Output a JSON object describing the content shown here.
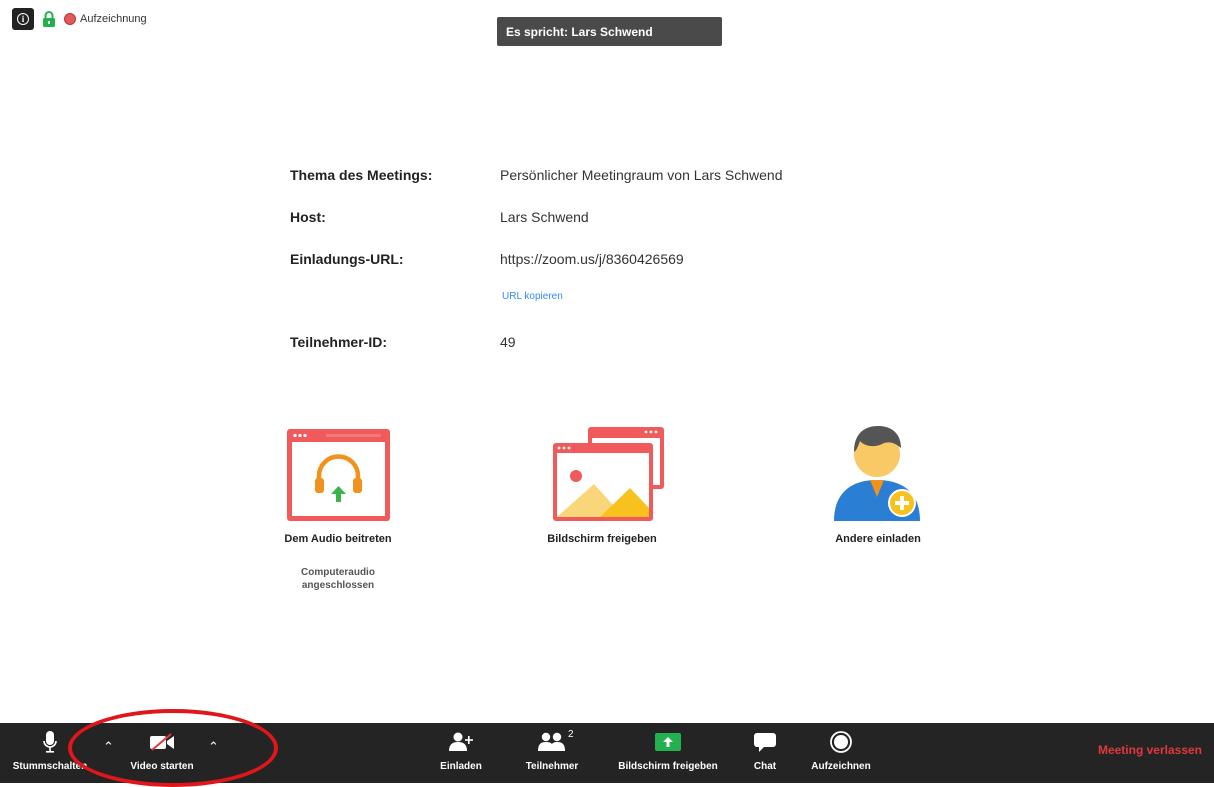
{
  "top_bar": {
    "recording_label": "Aufzeichnung"
  },
  "speaker_banner": "Es spricht: Lars Schwend",
  "meeting_info": {
    "topic_label": "Thema des Meetings:",
    "topic_value": "Persönlicher Meetingraum von Lars Schwend",
    "host_label": "Host:",
    "host_value": "Lars Schwend",
    "url_label": "Einladungs-URL:",
    "url_value": "https://zoom.us/j/8360426569",
    "copy_url_label": "URL kopieren",
    "participant_id_label": "Teilnehmer-ID:",
    "participant_id_value": "49"
  },
  "actions": {
    "join_audio": "Dem Audio beitreten",
    "join_audio_sub": "Computeraudio angeschlossen",
    "share_screen": "Bildschirm freigeben",
    "invite_others": "Andere einladen"
  },
  "toolbar": {
    "mute": "Stummschalten",
    "start_video": "Video starten",
    "invite": "Einladen",
    "participants": "Teilnehmer",
    "participants_count": "2",
    "share_screen": "Bildschirm freigeben",
    "chat": "Chat",
    "record": "Aufzeichnen",
    "leave": "Meeting verlassen"
  },
  "colors": {
    "toolbar_bg": "#242424",
    "accent_blue": "#2d8cff",
    "leave_red": "#e0383e",
    "share_green": "#23b14d",
    "tile_red": "#f05a5a",
    "annotation_red": "#e0161b"
  }
}
